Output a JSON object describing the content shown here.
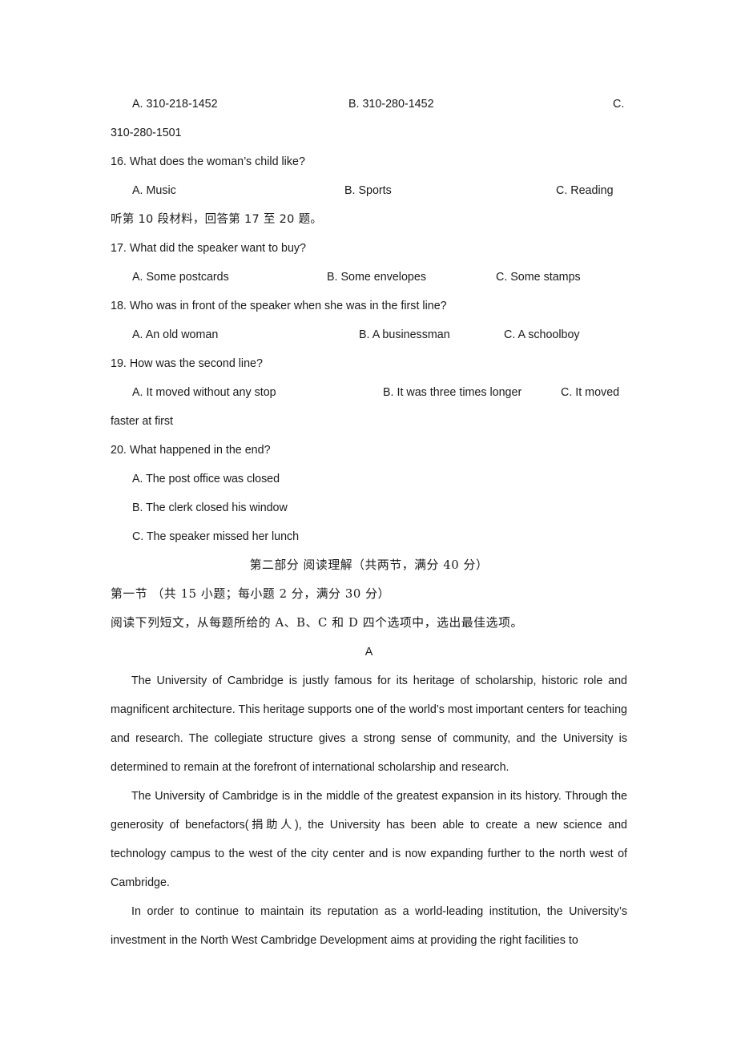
{
  "document": {
    "type": "exam-paper",
    "language_mix": [
      "en",
      "zh-Hans"
    ],
    "page_background": "#ffffff",
    "text_color": "#1a1a1a"
  },
  "listening_section": {
    "q15_options_tail": {
      "option_a": "A. 310-218-1452",
      "option_b": "B. 310-280-1452",
      "option_c_marker": "C.",
      "option_c_wrapped": "310-280-1501"
    },
    "questions": [
      {
        "number": "16",
        "stem": "16. What does the woman’s child like?",
        "options": [
          "A. Music",
          "B. Sports",
          "C. Reading"
        ]
      },
      {
        "number": "17",
        "stem": "17. What did the speaker want to buy?",
        "options": [
          "A. Some postcards",
          "B. Some envelopes",
          "C. Some stamps"
        ]
      },
      {
        "number": "18",
        "stem": "18. Who was in front of the speaker when she was in the first line?",
        "options": [
          "A. An old woman",
          "B. A businessman",
          "C. A schoolboy"
        ]
      },
      {
        "number": "19",
        "stem": "19. How was the second line?",
        "options": [
          "A. It moved without any stop",
          "B. It was three times longer",
          "C. It moved"
        ],
        "option_c_wrapped": "faster at first"
      },
      {
        "number": "20",
        "stem": "20. What happened in the end?",
        "options_stacked": [
          "A. The post office was closed",
          "B. The clerk closed his window",
          "C. The speaker missed her lunch"
        ]
      }
    ],
    "material_instruction": "听第 10 段材料，回答第 17 至 20 题。"
  },
  "reading_section": {
    "part_heading": "第二部分  阅读理解（共两节，满分 40 分）",
    "subsection_heading": "第一节 （共 15 小题；每小题 2 分，满分 30 分）",
    "instruction": "阅读下列短文，从每题所给的 A、B、C 和 D 四个选项中，选出最佳选项。",
    "passage_letter": "A",
    "paragraphs": [
      "The University of Cambridge is justly famous for its heritage of scholarship, historic role and magnificent architecture. This heritage supports one of the world’s most important centers for teaching and research. The collegiate structure gives a strong sense of community, and the University is determined to remain at the forefront of international scholarship and research.",
      "The University of Cambridge is in the middle of the greatest expansion in its history. Through the generosity of benefactors(捐助人), the University has been able to create a new science and technology campus to the west of the city center and is now expanding further to the north west of Cambridge.",
      "In order to continue to maintain its reputation as a world-leading institution, the University’s investment in the North West Cambridge Development aims at providing the right facilities to"
    ]
  }
}
